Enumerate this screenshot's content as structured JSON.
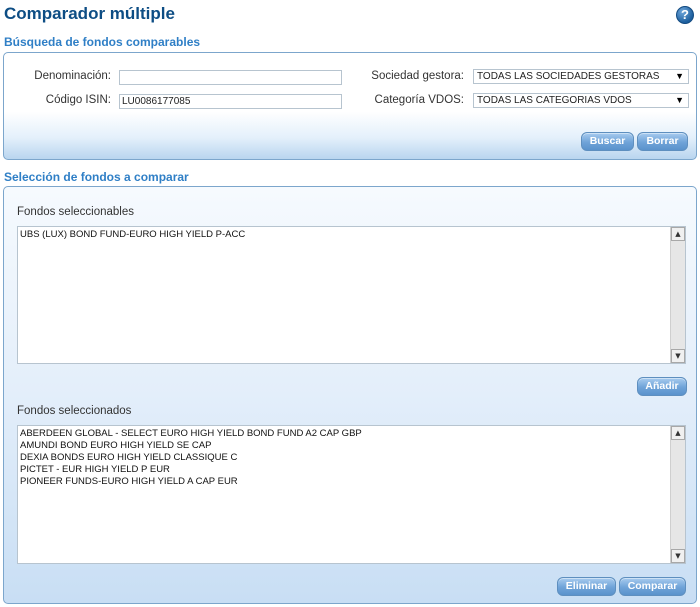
{
  "page": {
    "title": "Comparador múltiple",
    "help": "?"
  },
  "search": {
    "title": "Búsqueda de fondos comparables",
    "denominacion_label": "Denominación:",
    "denominacion_value": "",
    "isin_label": "Código ISIN:",
    "isin_value": "LU0086177085",
    "sociedad_label": "Sociedad gestora:",
    "sociedad_value": "TODAS LAS SOCIEDADES GESTORAS",
    "categoria_label": "Categoría VDOS:",
    "categoria_value": "TODAS LAS CATEGORIAS VDOS",
    "buscar": "Buscar",
    "borrar": "Borrar"
  },
  "selection": {
    "title": "Selección de fondos a comparar",
    "seleccionables_label": "Fondos seleccionables",
    "seleccionables": [
      "UBS (LUX) BOND FUND-EURO HIGH YIELD P-ACC"
    ],
    "anadir": "Añadir",
    "seleccionados_label": "Fondos seleccionados",
    "seleccionados": [
      "ABERDEEN GLOBAL - SELECT EURO HIGH YIELD BOND FUND A2 CAP GBP",
      "AMUNDI BOND EURO HIGH YIELD SE CAP",
      "DEXIA BONDS EURO HIGH YIELD CLASSIQUE C",
      "PICTET - EUR HIGH YIELD P EUR",
      "PIONEER FUNDS-EURO HIGH YIELD A CAP EUR"
    ],
    "eliminar": "Eliminar",
    "comparar": "Comparar"
  },
  "icons": {
    "up": "▲",
    "down": "▼",
    "dropdown": "▼"
  }
}
